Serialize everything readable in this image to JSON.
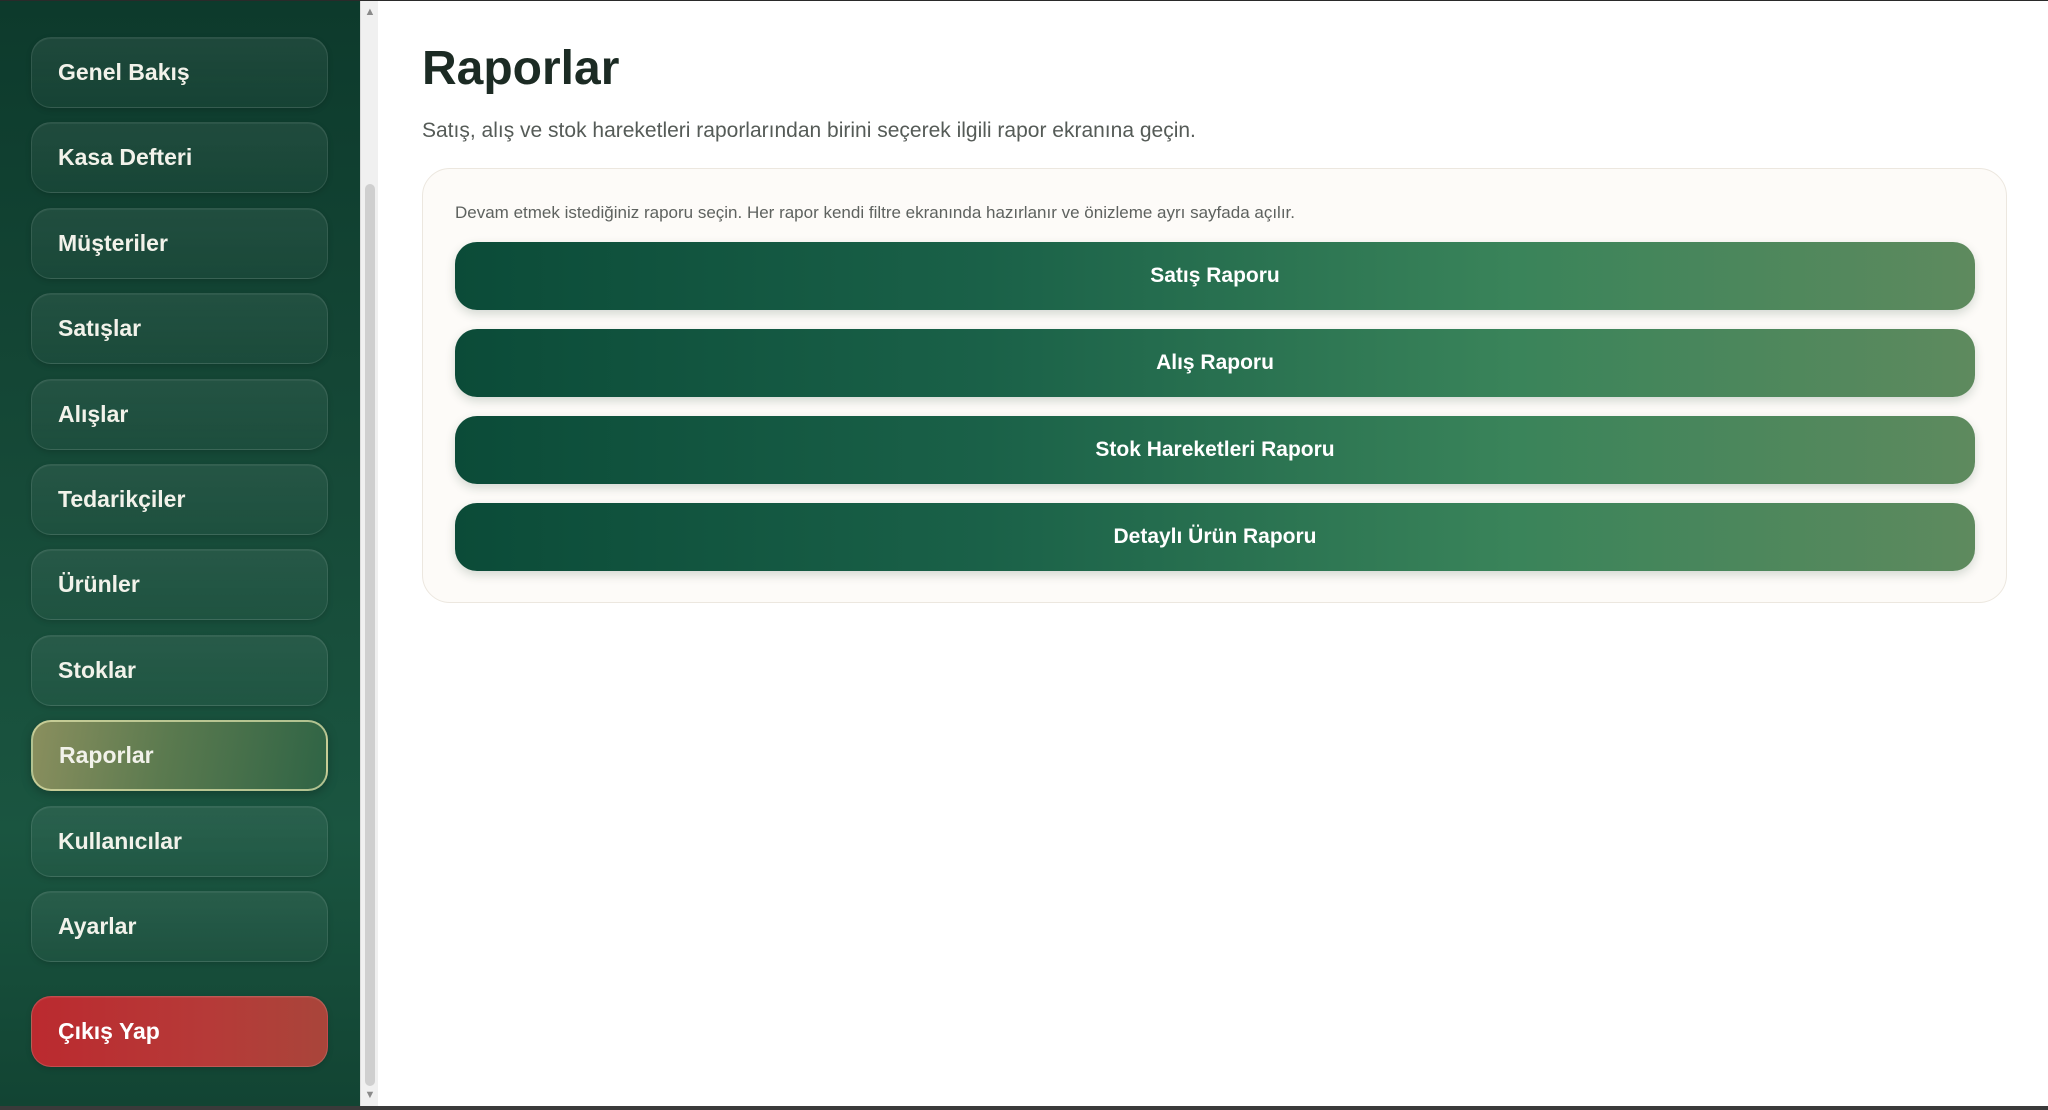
{
  "sidebar": {
    "items": [
      {
        "label": "Genel Bakış"
      },
      {
        "label": "Kasa Defteri"
      },
      {
        "label": "Müşteriler"
      },
      {
        "label": "Satışlar"
      },
      {
        "label": "Alışlar"
      },
      {
        "label": "Tedarikçiler"
      },
      {
        "label": "Ürünler"
      },
      {
        "label": "Stoklar"
      },
      {
        "label": "Raporlar",
        "active": true
      },
      {
        "label": "Kullanıcılar"
      },
      {
        "label": "Ayarlar"
      }
    ],
    "logout_label": "Çıkış Yap"
  },
  "main": {
    "title": "Raporlar",
    "subtitle": "Satış, alış ve stok hareketleri raporlarından birini seçerek ilgili rapor ekranına geçin.",
    "panel": {
      "hint": "Devam etmek istediğiniz raporu seçin. Her rapor kendi filtre ekranında hazırlanır ve önizleme ayrı sayfada açılır.",
      "buttons": [
        {
          "label": "Satış Raporu"
        },
        {
          "label": "Alış Raporu"
        },
        {
          "label": "Stok Hareketleri Raporu"
        },
        {
          "label": "Detaylı Ürün Raporu"
        }
      ]
    }
  },
  "colors": {
    "sidebar_bg": "#124433",
    "active_item": "#6f834f",
    "logout": "#b6363a",
    "report_button_start": "#0b4b38",
    "report_button_end": "#5e8a5e"
  }
}
